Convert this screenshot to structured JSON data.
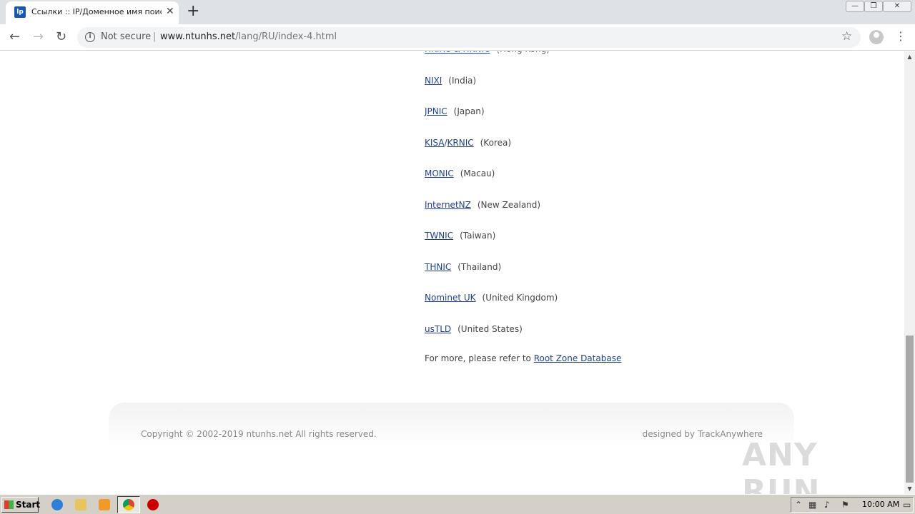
{
  "browser": {
    "tab_title": "Ссылки :: IP/Доменное имя поиска",
    "tab_favicon": "lp",
    "new_tab": "+",
    "security_label": "Not secure",
    "url_host": "www.ntunhs.net",
    "url_path": "/lang/RU/index-4.html"
  },
  "registries": [
    {
      "links": [
        "HKIRC & HKNIC"
      ],
      "country": "(Hong Kong)"
    },
    {
      "links": [
        "NIXI"
      ],
      "country": "(India)"
    },
    {
      "links": [
        "JPNIC"
      ],
      "country": "(Japan)"
    },
    {
      "links": [
        "KISA",
        "KRNIC"
      ],
      "country": "(Korea)"
    },
    {
      "links": [
        "MONIC"
      ],
      "country": "(Macau)"
    },
    {
      "links": [
        "InternetNZ"
      ],
      "country": "(New Zealand)"
    },
    {
      "links": [
        "TWNIC"
      ],
      "country": "(Taiwan)"
    },
    {
      "links": [
        "THNIC"
      ],
      "country": "(Thailand)"
    },
    {
      "links": [
        "Nominet UK"
      ],
      "country": "(United Kingdom)"
    },
    {
      "links": [
        "usTLD"
      ],
      "country": "(United States)"
    }
  ],
  "more": {
    "text": "For more, please refer to",
    "link": "Root Zone Database"
  },
  "footer": {
    "copyright": "Copyright © 2002-2019 ntunhs.net    All rights reserved.",
    "designed": "designed by TrackAnywhere"
  },
  "watermark": "ANY RUN",
  "taskbar": {
    "start_label": "Start",
    "clock": "10:00 AM"
  }
}
